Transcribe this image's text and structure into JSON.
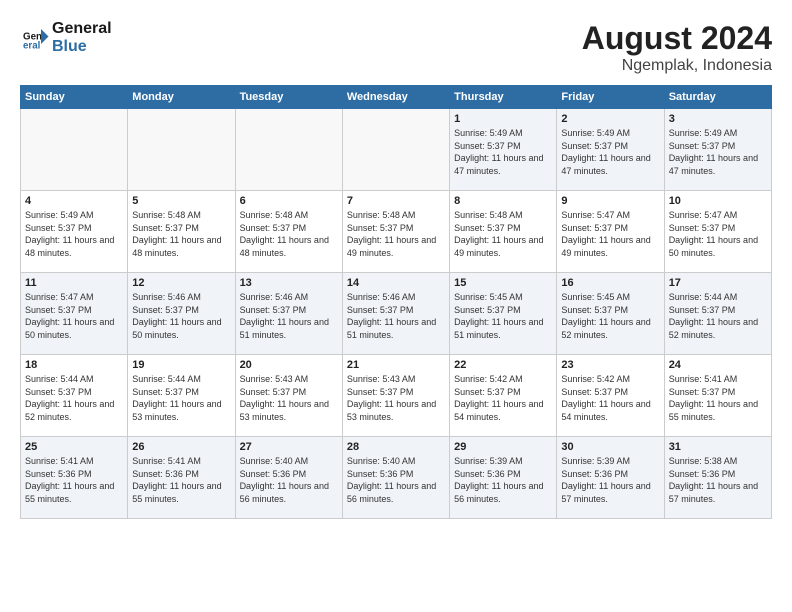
{
  "logo": {
    "line1": "General",
    "line2": "Blue"
  },
  "title": "August 2024",
  "location": "Ngemplak, Indonesia",
  "weekdays": [
    "Sunday",
    "Monday",
    "Tuesday",
    "Wednesday",
    "Thursday",
    "Friday",
    "Saturday"
  ],
  "weeks": [
    [
      {
        "day": "",
        "sunrise": "",
        "sunset": "",
        "daylight": ""
      },
      {
        "day": "",
        "sunrise": "",
        "sunset": "",
        "daylight": ""
      },
      {
        "day": "",
        "sunrise": "",
        "sunset": "",
        "daylight": ""
      },
      {
        "day": "",
        "sunrise": "",
        "sunset": "",
        "daylight": ""
      },
      {
        "day": "1",
        "sunrise": "Sunrise: 5:49 AM",
        "sunset": "Sunset: 5:37 PM",
        "daylight": "Daylight: 11 hours and 47 minutes."
      },
      {
        "day": "2",
        "sunrise": "Sunrise: 5:49 AM",
        "sunset": "Sunset: 5:37 PM",
        "daylight": "Daylight: 11 hours and 47 minutes."
      },
      {
        "day": "3",
        "sunrise": "Sunrise: 5:49 AM",
        "sunset": "Sunset: 5:37 PM",
        "daylight": "Daylight: 11 hours and 47 minutes."
      }
    ],
    [
      {
        "day": "4",
        "sunrise": "Sunrise: 5:49 AM",
        "sunset": "Sunset: 5:37 PM",
        "daylight": "Daylight: 11 hours and 48 minutes."
      },
      {
        "day": "5",
        "sunrise": "Sunrise: 5:48 AM",
        "sunset": "Sunset: 5:37 PM",
        "daylight": "Daylight: 11 hours and 48 minutes."
      },
      {
        "day": "6",
        "sunrise": "Sunrise: 5:48 AM",
        "sunset": "Sunset: 5:37 PM",
        "daylight": "Daylight: 11 hours and 48 minutes."
      },
      {
        "day": "7",
        "sunrise": "Sunrise: 5:48 AM",
        "sunset": "Sunset: 5:37 PM",
        "daylight": "Daylight: 11 hours and 49 minutes."
      },
      {
        "day": "8",
        "sunrise": "Sunrise: 5:48 AM",
        "sunset": "Sunset: 5:37 PM",
        "daylight": "Daylight: 11 hours and 49 minutes."
      },
      {
        "day": "9",
        "sunrise": "Sunrise: 5:47 AM",
        "sunset": "Sunset: 5:37 PM",
        "daylight": "Daylight: 11 hours and 49 minutes."
      },
      {
        "day": "10",
        "sunrise": "Sunrise: 5:47 AM",
        "sunset": "Sunset: 5:37 PM",
        "daylight": "Daylight: 11 hours and 50 minutes."
      }
    ],
    [
      {
        "day": "11",
        "sunrise": "Sunrise: 5:47 AM",
        "sunset": "Sunset: 5:37 PM",
        "daylight": "Daylight: 11 hours and 50 minutes."
      },
      {
        "day": "12",
        "sunrise": "Sunrise: 5:46 AM",
        "sunset": "Sunset: 5:37 PM",
        "daylight": "Daylight: 11 hours and 50 minutes."
      },
      {
        "day": "13",
        "sunrise": "Sunrise: 5:46 AM",
        "sunset": "Sunset: 5:37 PM",
        "daylight": "Daylight: 11 hours and 51 minutes."
      },
      {
        "day": "14",
        "sunrise": "Sunrise: 5:46 AM",
        "sunset": "Sunset: 5:37 PM",
        "daylight": "Daylight: 11 hours and 51 minutes."
      },
      {
        "day": "15",
        "sunrise": "Sunrise: 5:45 AM",
        "sunset": "Sunset: 5:37 PM",
        "daylight": "Daylight: 11 hours and 51 minutes."
      },
      {
        "day": "16",
        "sunrise": "Sunrise: 5:45 AM",
        "sunset": "Sunset: 5:37 PM",
        "daylight": "Daylight: 11 hours and 52 minutes."
      },
      {
        "day": "17",
        "sunrise": "Sunrise: 5:44 AM",
        "sunset": "Sunset: 5:37 PM",
        "daylight": "Daylight: 11 hours and 52 minutes."
      }
    ],
    [
      {
        "day": "18",
        "sunrise": "Sunrise: 5:44 AM",
        "sunset": "Sunset: 5:37 PM",
        "daylight": "Daylight: 11 hours and 52 minutes."
      },
      {
        "day": "19",
        "sunrise": "Sunrise: 5:44 AM",
        "sunset": "Sunset: 5:37 PM",
        "daylight": "Daylight: 11 hours and 53 minutes."
      },
      {
        "day": "20",
        "sunrise": "Sunrise: 5:43 AM",
        "sunset": "Sunset: 5:37 PM",
        "daylight": "Daylight: 11 hours and 53 minutes."
      },
      {
        "day": "21",
        "sunrise": "Sunrise: 5:43 AM",
        "sunset": "Sunset: 5:37 PM",
        "daylight": "Daylight: 11 hours and 53 minutes."
      },
      {
        "day": "22",
        "sunrise": "Sunrise: 5:42 AM",
        "sunset": "Sunset: 5:37 PM",
        "daylight": "Daylight: 11 hours and 54 minutes."
      },
      {
        "day": "23",
        "sunrise": "Sunrise: 5:42 AM",
        "sunset": "Sunset: 5:37 PM",
        "daylight": "Daylight: 11 hours and 54 minutes."
      },
      {
        "day": "24",
        "sunrise": "Sunrise: 5:41 AM",
        "sunset": "Sunset: 5:37 PM",
        "daylight": "Daylight: 11 hours and 55 minutes."
      }
    ],
    [
      {
        "day": "25",
        "sunrise": "Sunrise: 5:41 AM",
        "sunset": "Sunset: 5:36 PM",
        "daylight": "Daylight: 11 hours and 55 minutes."
      },
      {
        "day": "26",
        "sunrise": "Sunrise: 5:41 AM",
        "sunset": "Sunset: 5:36 PM",
        "daylight": "Daylight: 11 hours and 55 minutes."
      },
      {
        "day": "27",
        "sunrise": "Sunrise: 5:40 AM",
        "sunset": "Sunset: 5:36 PM",
        "daylight": "Daylight: 11 hours and 56 minutes."
      },
      {
        "day": "28",
        "sunrise": "Sunrise: 5:40 AM",
        "sunset": "Sunset: 5:36 PM",
        "daylight": "Daylight: 11 hours and 56 minutes."
      },
      {
        "day": "29",
        "sunrise": "Sunrise: 5:39 AM",
        "sunset": "Sunset: 5:36 PM",
        "daylight": "Daylight: 11 hours and 56 minutes."
      },
      {
        "day": "30",
        "sunrise": "Sunrise: 5:39 AM",
        "sunset": "Sunset: 5:36 PM",
        "daylight": "Daylight: 11 hours and 57 minutes."
      },
      {
        "day": "31",
        "sunrise": "Sunrise: 5:38 AM",
        "sunset": "Sunset: 5:36 PM",
        "daylight": "Daylight: 11 hours and 57 minutes."
      }
    ]
  ]
}
